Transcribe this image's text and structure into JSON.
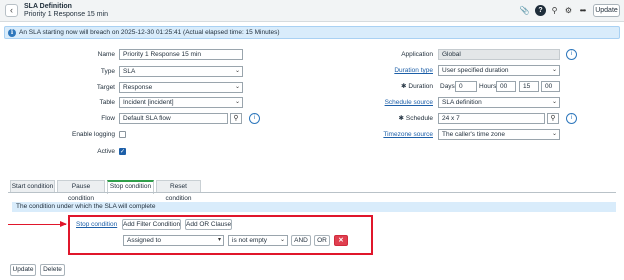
{
  "header": {
    "title": "SLA Definition",
    "subtitle": "Priority 1 Response 15 min",
    "update_label": "Update",
    "icons": [
      "attachment-icon",
      "help-icon",
      "activity-icon",
      "settings-icon",
      "more-icon"
    ]
  },
  "banner": {
    "text": "An SLA starting now will breach on 2025-12-30 01:25:41 (Actual elapsed time: 15 Minutes)"
  },
  "form": {
    "name": {
      "label": "Name",
      "value": "Priority 1 Response 15 min"
    },
    "type": {
      "label": "Type",
      "value": "SLA"
    },
    "target": {
      "label": "Target",
      "value": "Response"
    },
    "table": {
      "label": "Table",
      "value": "Incident [incident]"
    },
    "flow": {
      "label": "Flow",
      "value": "Default SLA flow"
    },
    "enable_logging": {
      "label": "Enable logging",
      "checked": false
    },
    "active": {
      "label": "Active",
      "checked": true
    },
    "application": {
      "label": "Application",
      "value": "Global"
    },
    "duration_type": {
      "label": "Duration type",
      "value": "User specified duration"
    },
    "duration": {
      "label": "Duration",
      "days_label": "Days",
      "days": "0",
      "hours_label": "Hours",
      "hours": "00",
      "minutes": "15",
      "seconds": "00"
    },
    "schedule_source": {
      "label": "Schedule source",
      "value": "SLA definition"
    },
    "schedule": {
      "label": "Schedule",
      "value": "24 x 7"
    },
    "timezone_source": {
      "label": "Timezone source",
      "value": "The caller's time zone"
    }
  },
  "tabs": [
    {
      "label": "Start condition",
      "active": false
    },
    {
      "label": "Pause condition",
      "active": false
    },
    {
      "label": "Stop condition",
      "active": true
    },
    {
      "label": "Reset condition",
      "active": false
    }
  ],
  "condition": {
    "banner": "The condition under which the SLA will complete",
    "label": "Stop condition",
    "add_filter_label": "Add Filter Condition",
    "add_or_label": "Add OR Clause",
    "field": "Assigned to",
    "operator": "is not empty",
    "and_label": "AND",
    "or_label": "OR",
    "delete_label": "✕"
  },
  "footer": {
    "update_label": "Update",
    "delete_label": "Delete"
  },
  "colors": {
    "accent": "#1d5fa8",
    "active_tab": "#2f9e4a",
    "highlight": "#e0162b",
    "delete": "#e03f4f"
  }
}
